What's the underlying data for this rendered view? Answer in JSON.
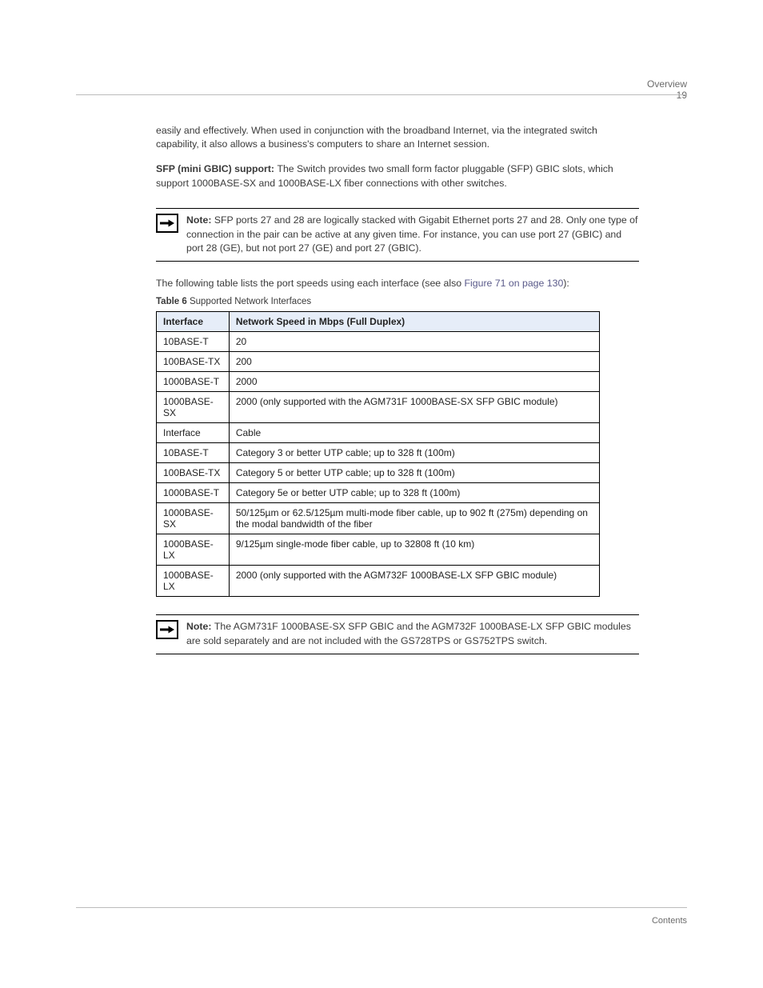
{
  "header": {
    "title": "Overview",
    "page": "19"
  },
  "paragraphs": {
    "p1": "easily and effectively. When used in conjunction with the broadband Internet, via the integrated switch capability, it also allows a business's computers to share an Internet session.",
    "p2_lead": "SFP (mini GBIC) support: ",
    "p2_body": "The Switch provides two small form factor pluggable (SFP) GBIC slots, which support 1000BASE-SX and 1000BASE-LX fiber connections with other switches.",
    "note1_label": "Note: ",
    "note1_body": "SFP ports 27 and 28 are logically stacked with Gigabit Ethernet ports 27 and 28. Only one type of connection in the pair can be active at any given time. For instance, you can use port 27 (GBIC) and port 28 (GE), but not port 27 (GE) and port 27 (GBIC).",
    "table_intro_pre": "The following table lists the port speeds using each interface (see also ",
    "table_intro_xref": "Figure 71 on page 130",
    "table_intro_post": "):"
  },
  "table": {
    "caption_label": "Table 6 ",
    "caption_text": "Supported Network Interfaces",
    "headers": {
      "c1": "Interface",
      "c2": "Network Speed in Mbps (Full Duplex)"
    },
    "rows": [
      {
        "c1": "10BASE-T",
        "c2": "20"
      },
      {
        "c1": "100BASE-TX",
        "c2": "200"
      },
      {
        "c1": "1000BASE-T",
        "c2": "2000"
      },
      {
        "c1": "1000BASE-SX",
        "c2": "2000 (only supported with the AGM731F 1000BASE-SX SFP GBIC module)"
      },
      {
        "c1": "Interface",
        "c2": "Cable"
      },
      {
        "c1": "10BASE-T",
        "c2": "Category 3 or better UTP cable; up to 328 ft (100m)"
      },
      {
        "c1": "100BASE-TX",
        "c2": "Category 5 or better UTP cable; up to 328 ft (100m)"
      },
      {
        "c1": "1000BASE-T",
        "c2": "Category 5e or better UTP cable; up to 328 ft (100m)"
      },
      {
        "c1": "1000BASE-SX",
        "c2": "50/125µm or 62.5/125µm multi-mode fiber cable, up to 902 ft (275m) depending on the modal bandwidth of the fiber"
      },
      {
        "c1": "1000BASE-LX",
        "c2": "9/125µm single-mode fiber cable, up to 32808 ft (10 km)"
      },
      {
        "c1": "1000BASE-LX",
        "c2": "2000 (only supported with the AGM732F 1000BASE-LX SFP GBIC module)"
      }
    ]
  },
  "note2": {
    "label": "Note: ",
    "body": "The AGM731F 1000BASE-SX SFP GBIC and the AGM732F 1000BASE-LX SFP GBIC modules are sold separately and are not included with the GS728TPS or GS752TPS switch."
  },
  "footer": {
    "text": "Contents"
  }
}
